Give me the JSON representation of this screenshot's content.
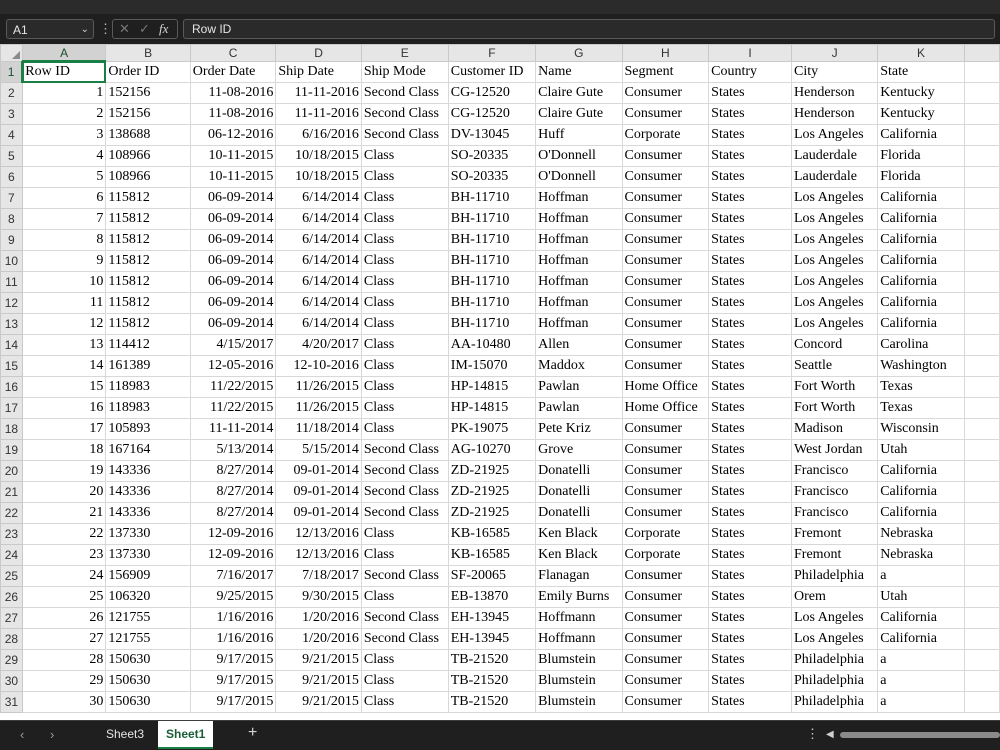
{
  "formula_bar": {
    "name_box": "A1",
    "fx_label": "fx",
    "formula_value": "Row ID"
  },
  "grid": {
    "columns": [
      "A",
      "B",
      "C",
      "D",
      "E",
      "F",
      "G",
      "H",
      "I",
      "J",
      "K"
    ],
    "rows": [
      [
        "Row ID",
        "Order ID",
        "Order Date",
        "Ship Date",
        "Ship Mode",
        "Customer ID",
        "Name",
        "Segment",
        "Country",
        "City",
        "State"
      ],
      [
        "1",
        "152156",
        "11-08-2016",
        "11-11-2016",
        "Second Class",
        "CG-12520",
        "Claire Gute",
        "Consumer",
        "States",
        "Henderson",
        "Kentucky"
      ],
      [
        "2",
        "152156",
        "11-08-2016",
        "11-11-2016",
        "Second Class",
        "CG-12520",
        "Claire Gute",
        "Consumer",
        "States",
        "Henderson",
        "Kentucky"
      ],
      [
        "3",
        "138688",
        "06-12-2016",
        "6/16/2016",
        "Second Class",
        "DV-13045",
        "Huff",
        "Corporate",
        "States",
        "Los Angeles",
        "California"
      ],
      [
        "4",
        "108966",
        "10-11-2015",
        "10/18/2015",
        "Class",
        "SO-20335",
        "O'Donnell",
        "Consumer",
        "States",
        "Lauderdale",
        "Florida"
      ],
      [
        "5",
        "108966",
        "10-11-2015",
        "10/18/2015",
        "Class",
        "SO-20335",
        "O'Donnell",
        "Consumer",
        "States",
        "Lauderdale",
        "Florida"
      ],
      [
        "6",
        "115812",
        "06-09-2014",
        "6/14/2014",
        "Class",
        "BH-11710",
        "Hoffman",
        "Consumer",
        "States",
        "Los Angeles",
        "California"
      ],
      [
        "7",
        "115812",
        "06-09-2014",
        "6/14/2014",
        "Class",
        "BH-11710",
        "Hoffman",
        "Consumer",
        "States",
        "Los Angeles",
        "California"
      ],
      [
        "8",
        "115812",
        "06-09-2014",
        "6/14/2014",
        "Class",
        "BH-11710",
        "Hoffman",
        "Consumer",
        "States",
        "Los Angeles",
        "California"
      ],
      [
        "9",
        "115812",
        "06-09-2014",
        "6/14/2014",
        "Class",
        "BH-11710",
        "Hoffman",
        "Consumer",
        "States",
        "Los Angeles",
        "California"
      ],
      [
        "10",
        "115812",
        "06-09-2014",
        "6/14/2014",
        "Class",
        "BH-11710",
        "Hoffman",
        "Consumer",
        "States",
        "Los Angeles",
        "California"
      ],
      [
        "11",
        "115812",
        "06-09-2014",
        "6/14/2014",
        "Class",
        "BH-11710",
        "Hoffman",
        "Consumer",
        "States",
        "Los Angeles",
        "California"
      ],
      [
        "12",
        "115812",
        "06-09-2014",
        "6/14/2014",
        "Class",
        "BH-11710",
        "Hoffman",
        "Consumer",
        "States",
        "Los Angeles",
        "California"
      ],
      [
        "13",
        "114412",
        "4/15/2017",
        "4/20/2017",
        "Class",
        "AA-10480",
        "Allen",
        "Consumer",
        "States",
        "Concord",
        "Carolina"
      ],
      [
        "14",
        "161389",
        "12-05-2016",
        "12-10-2016",
        "Class",
        "IM-15070",
        "Maddox",
        "Consumer",
        "States",
        "Seattle",
        "Washington"
      ],
      [
        "15",
        "118983",
        "11/22/2015",
        "11/26/2015",
        "Class",
        "HP-14815",
        "Pawlan",
        "Home Office",
        "States",
        "Fort Worth",
        "Texas"
      ],
      [
        "16",
        "118983",
        "11/22/2015",
        "11/26/2015",
        "Class",
        "HP-14815",
        "Pawlan",
        "Home Office",
        "States",
        "Fort Worth",
        "Texas"
      ],
      [
        "17",
        "105893",
        "11-11-2014",
        "11/18/2014",
        "Class",
        "PK-19075",
        "Pete Kriz",
        "Consumer",
        "States",
        "Madison",
        "Wisconsin"
      ],
      [
        "18",
        "167164",
        "5/13/2014",
        "5/15/2014",
        "Second Class",
        "AG-10270",
        "Grove",
        "Consumer",
        "States",
        "West Jordan",
        "Utah"
      ],
      [
        "19",
        "143336",
        "8/27/2014",
        "09-01-2014",
        "Second Class",
        "ZD-21925",
        "Donatelli",
        "Consumer",
        "States",
        "Francisco",
        "California"
      ],
      [
        "20",
        "143336",
        "8/27/2014",
        "09-01-2014",
        "Second Class",
        "ZD-21925",
        "Donatelli",
        "Consumer",
        "States",
        "Francisco",
        "California"
      ],
      [
        "21",
        "143336",
        "8/27/2014",
        "09-01-2014",
        "Second Class",
        "ZD-21925",
        "Donatelli",
        "Consumer",
        "States",
        "Francisco",
        "California"
      ],
      [
        "22",
        "137330",
        "12-09-2016",
        "12/13/2016",
        "Class",
        "KB-16585",
        "Ken Black",
        "Corporate",
        "States",
        "Fremont",
        "Nebraska"
      ],
      [
        "23",
        "137330",
        "12-09-2016",
        "12/13/2016",
        "Class",
        "KB-16585",
        "Ken Black",
        "Corporate",
        "States",
        "Fremont",
        "Nebraska"
      ],
      [
        "24",
        "156909",
        "7/16/2017",
        "7/18/2017",
        "Second Class",
        "SF-20065",
        "Flanagan",
        "Consumer",
        "States",
        "Philadelphia",
        "a"
      ],
      [
        "25",
        "106320",
        "9/25/2015",
        "9/30/2015",
        "Class",
        "EB-13870",
        "Emily Burns",
        "Consumer",
        "States",
        "Orem",
        "Utah"
      ],
      [
        "26",
        "121755",
        "1/16/2016",
        "1/20/2016",
        "Second Class",
        "EH-13945",
        "Hoffmann",
        "Consumer",
        "States",
        "Los Angeles",
        "California"
      ],
      [
        "27",
        "121755",
        "1/16/2016",
        "1/20/2016",
        "Second Class",
        "EH-13945",
        "Hoffmann",
        "Consumer",
        "States",
        "Los Angeles",
        "California"
      ],
      [
        "28",
        "150630",
        "9/17/2015",
        "9/21/2015",
        "Class",
        "TB-21520",
        "Blumstein",
        "Consumer",
        "States",
        "Philadelphia",
        "a"
      ],
      [
        "29",
        "150630",
        "9/17/2015",
        "9/21/2015",
        "Class",
        "TB-21520",
        "Blumstein",
        "Consumer",
        "States",
        "Philadelphia",
        "a"
      ],
      [
        "30",
        "150630",
        "9/17/2015",
        "9/21/2015",
        "Class",
        "TB-21520",
        "Blumstein",
        "Consumer",
        "States",
        "Philadelphia",
        "a"
      ]
    ]
  },
  "sheet_tabs": [
    {
      "label": "Sheet3",
      "active": false
    },
    {
      "label": "Sheet1",
      "active": true
    }
  ],
  "colors": {
    "accent": "#1a7f45"
  }
}
